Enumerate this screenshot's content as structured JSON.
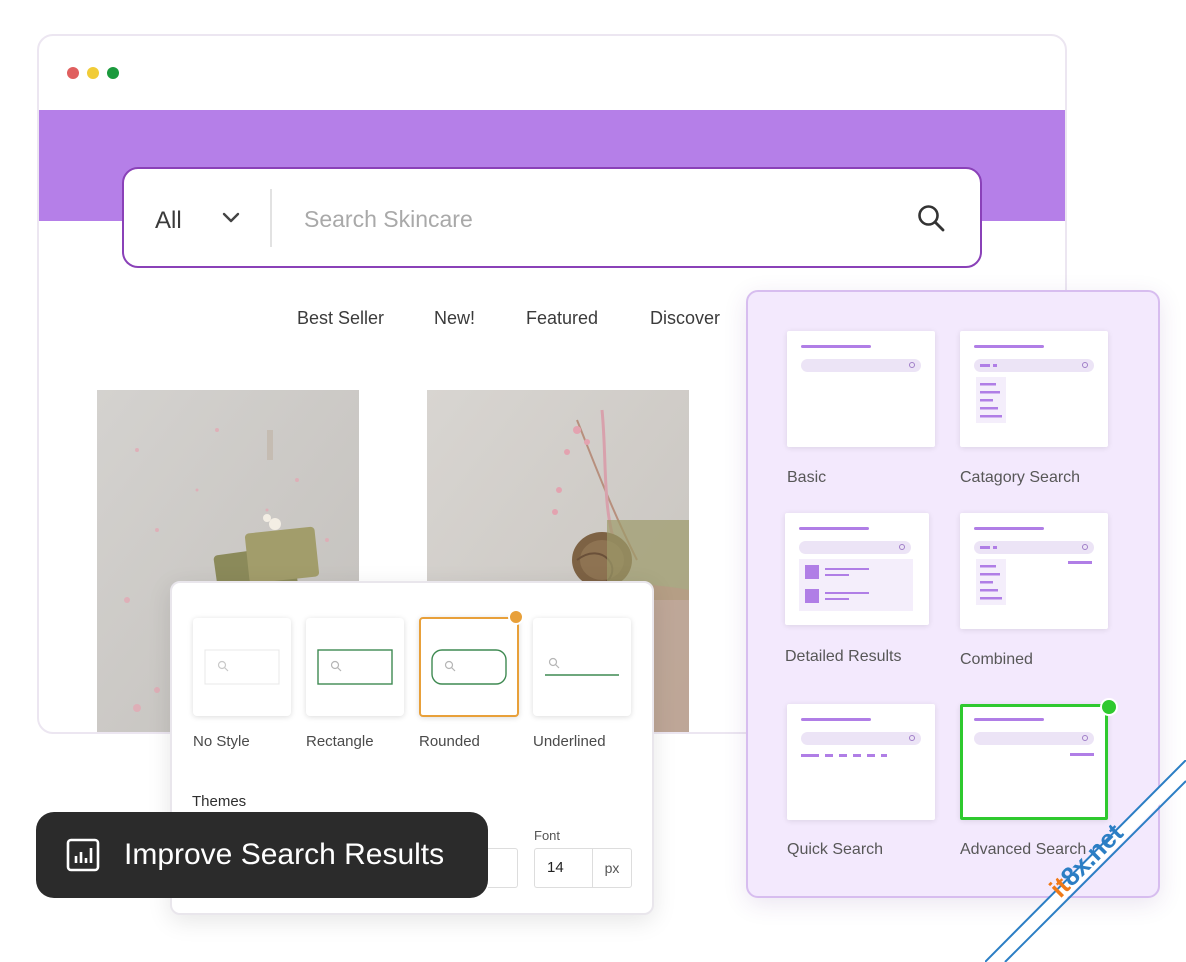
{
  "browser": {
    "window_controls": {
      "close_color": "#e05f5f",
      "minimize_color": "#f1cc37",
      "maximize_color": "#1b9a3d"
    },
    "hero_color": "#b57fe8"
  },
  "search": {
    "category_value": "All",
    "placeholder": "Search Skincare",
    "icons": {
      "chevron": "chevron-down-icon",
      "search": "search-icon"
    }
  },
  "nav": {
    "items": [
      "Best Seller",
      "New!",
      "Featured",
      "Discover"
    ]
  },
  "style_panel": {
    "options": [
      "No Style",
      "Rectangle",
      "Rounded",
      "Underlined"
    ],
    "selected": "Rounded",
    "accent_color": "#e8a03a",
    "themes_label": "Themes",
    "font_label": "Font",
    "font_value": "14",
    "font_unit": "px"
  },
  "cta": {
    "icon": "bar-chart-icon",
    "label": "Improve Search Results"
  },
  "layouts": {
    "cards": [
      "Basic",
      "Catagory Search",
      "Detailed Results",
      "Combined",
      "Quick Search",
      "Advanced Search"
    ],
    "selected": "Advanced Search",
    "selected_color": "#2fc92f"
  },
  "watermark": "it8x.net"
}
